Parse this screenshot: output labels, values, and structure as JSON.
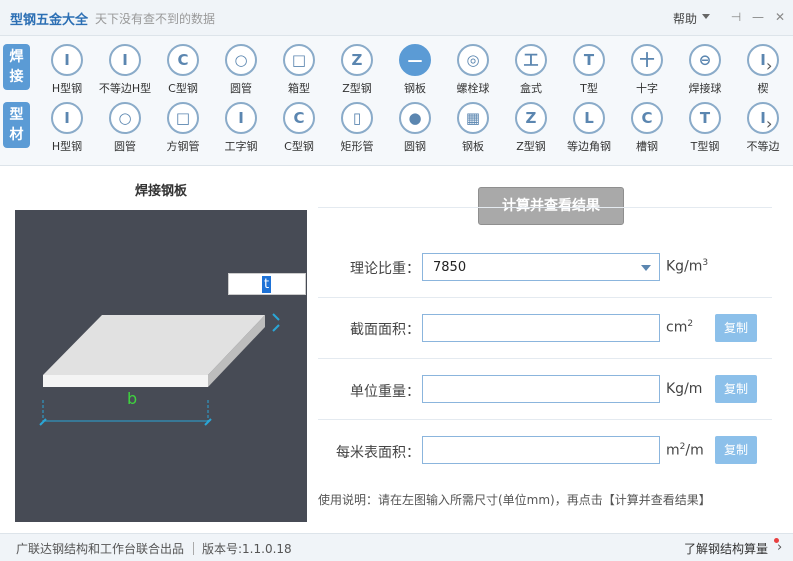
{
  "app": {
    "title": "型钢五金大全",
    "slogan": "天下没有查不到的数据",
    "help": "帮助",
    "window_buttons": [
      "pin-icon",
      "minimize-icon",
      "close-icon"
    ]
  },
  "toolbar": {
    "row1": {
      "label": "焊接",
      "items": [
        {
          "label": "H型钢",
          "glyph": "I"
        },
        {
          "label": "不等边H型",
          "glyph": "I"
        },
        {
          "label": "C型钢",
          "glyph": "C"
        },
        {
          "label": "圆管",
          "glyph": "○"
        },
        {
          "label": "箱型",
          "glyph": "□"
        },
        {
          "label": "Z型钢",
          "glyph": "Z"
        },
        {
          "label": "钢板",
          "glyph": "—"
        },
        {
          "label": "螺栓球",
          "glyph": "◎"
        },
        {
          "label": "盒式",
          "glyph": "工"
        },
        {
          "label": "T型",
          "glyph": "T"
        },
        {
          "label": "十字",
          "glyph": "十"
        },
        {
          "label": "焊接球",
          "glyph": "⊖"
        },
        {
          "label": "楔",
          "glyph": "I"
        }
      ]
    },
    "row2": {
      "label": "型材",
      "items": [
        {
          "label": "H型钢",
          "glyph": "I"
        },
        {
          "label": "圆管",
          "glyph": "○"
        },
        {
          "label": "方钢管",
          "glyph": "□"
        },
        {
          "label": "工字钢",
          "glyph": "I"
        },
        {
          "label": "C型钢",
          "glyph": "C"
        },
        {
          "label": "矩形管",
          "glyph": "▯"
        },
        {
          "label": "圆钢",
          "glyph": "●"
        },
        {
          "label": "钢板",
          "glyph": "▦"
        },
        {
          "label": "Z型钢",
          "glyph": "Z"
        },
        {
          "label": "等边角钢",
          "glyph": "L"
        },
        {
          "label": "槽钢",
          "glyph": "C"
        },
        {
          "label": "T型钢",
          "glyph": "T"
        },
        {
          "label": "不等边",
          "glyph": "I"
        }
      ]
    }
  },
  "diagram": {
    "title": "焊接钢板",
    "t_value": "t",
    "b_label": "b"
  },
  "calc_button": "计算并查看结果",
  "fields": {
    "density": {
      "label": "理论比重：",
      "value": "7850",
      "unit": "Kg/m",
      "unit_sup": "3"
    },
    "area": {
      "label": "截面面积：",
      "value": "",
      "unit": "cm",
      "unit_sup": "2",
      "copy": "复制"
    },
    "unit_weight": {
      "label": "单位重量：",
      "value": "",
      "unit": "Kg/m",
      "copy": "复制"
    },
    "surface": {
      "label": "每米表面积：",
      "value": "",
      "unit_pre": "m",
      "unit_sup": "2",
      "unit_post": "/m",
      "copy": "复制"
    }
  },
  "instructions": "使用说明：请在左图输入所需尺寸(单位mm)，再点击【计算并查看结果】",
  "status": {
    "publisher": "广联达钢结构和工作台联合出品",
    "version": "版本号:1.1.0.18",
    "link": "了解钢结构算量"
  },
  "colors": {
    "accent": "#5b9bd5",
    "title_blue": "#2c6fb4",
    "diagram_bg": "#474b55",
    "plate_top": "#e1e1e1",
    "dimension_cyan": "#2aa6d6",
    "b_label_green": "#3ed33e"
  }
}
